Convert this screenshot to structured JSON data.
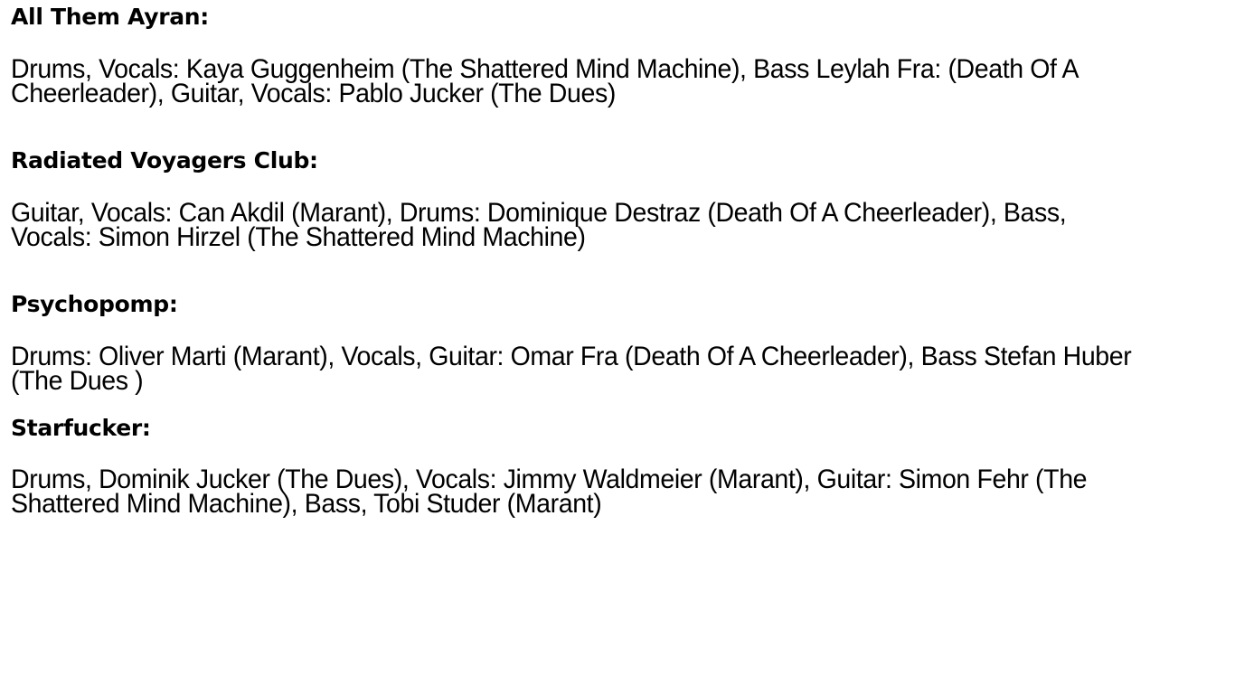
{
  "bands": [
    {
      "name": "All Them Ayran:",
      "lineup": "Drums, Vocals: Kaya Guggenheim (The Shattered Mind Machine), Bass Leylah Fra: (Death Of A Cheerleader), Guitar, Vocals: Pablo Jucker (The Dues)"
    },
    {
      "name": "Radiated Voyagers Club:",
      "lineup": "Guitar, Vocals: Can Akdil (Marant), Drums: Dominique Destraz (Death Of A Cheerleader), Bass, Vocals: Simon Hirzel (The Shattered Mind Machine)"
    },
    {
      "name": "Psychopomp:",
      "lineup": "Drums: Oliver Marti (Marant), Vocals, Guitar: Omar Fra (Death Of A Cheerleader), Bass Stefan Huber (The Dues )"
    },
    {
      "name": "Starfucker:",
      "lineup": "Drums, Dominik Jucker (The Dues), Vocals: Jimmy Waldmeier (Marant), Guitar: Simon Fehr (The Shattered Mind Machine), Bass, Tobi Studer (Marant)"
    }
  ]
}
